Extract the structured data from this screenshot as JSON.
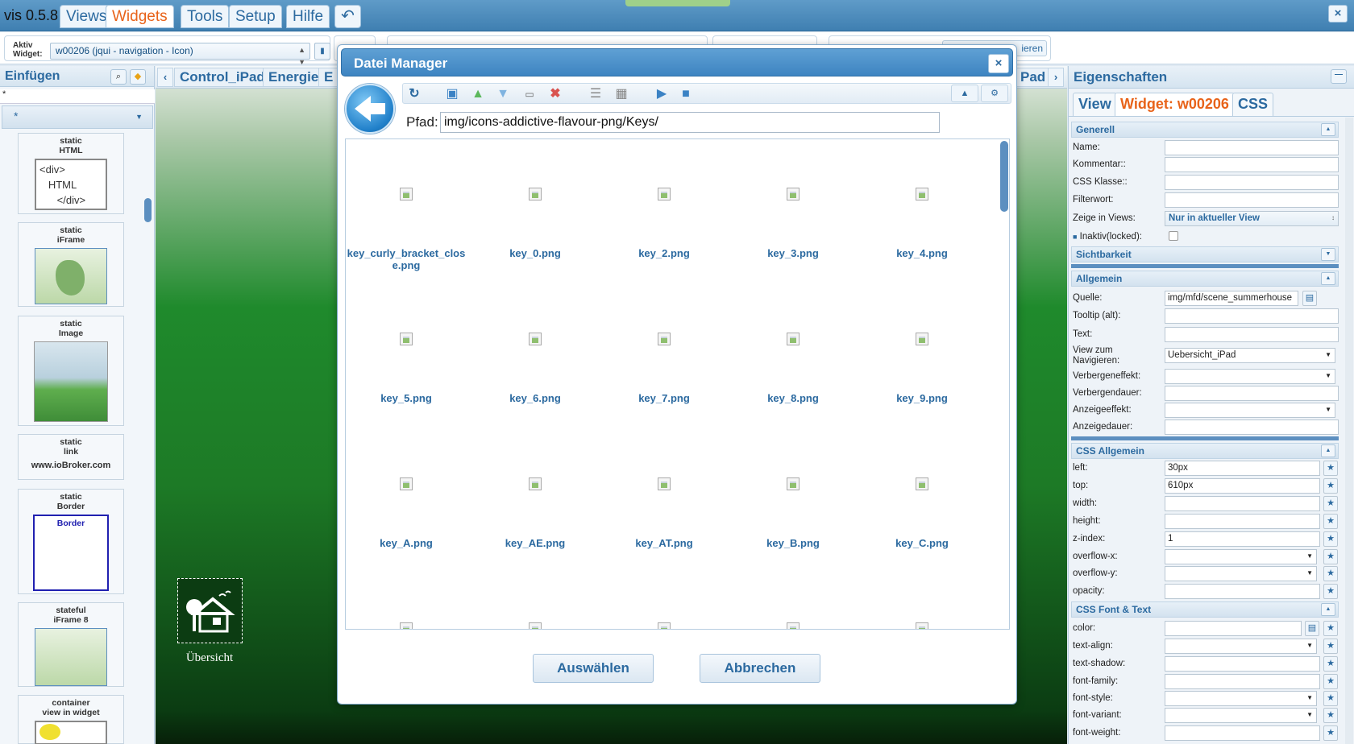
{
  "app": {
    "title": "vis 0.5.8",
    "menu": [
      "Views",
      "Widgets",
      "Tools",
      "Setup",
      "Hilfe"
    ],
    "active_menu": "Widgets",
    "undo_icon": "undo-arrow-icon",
    "close_icon": "close-icon"
  },
  "toolbar": {
    "aktiv_label_1": "Aktiv",
    "aktiv_label_2": "Widget:",
    "widget_select": "w00206 (jqui - navigation - Icon)",
    "partial_button": "ieren"
  },
  "left_panel": {
    "title": "Einfügen",
    "filter_value": "*",
    "filter_select": "*",
    "widgets": [
      {
        "set": "static",
        "name": "HTML",
        "preview": "<div>\n   HTML\n      </div>"
      },
      {
        "set": "static",
        "name": "iFrame",
        "preview": ""
      },
      {
        "set": "static",
        "name": "Image",
        "preview": ""
      },
      {
        "set": "static",
        "name": "link",
        "preview": "www.ioBroker.com"
      },
      {
        "set": "static",
        "name": "Border",
        "preview": "Border"
      },
      {
        "set": "stateful",
        "name": "iFrame 8",
        "preview": ""
      },
      {
        "set": "container",
        "name": "view in widget",
        "preview": ""
      }
    ]
  },
  "stage": {
    "tabs": [
      "Control_iPad",
      "Energie",
      "E",
      "Pad"
    ],
    "icon_label": "Übersicht"
  },
  "right_panel": {
    "title": "Eigenschaften",
    "tabs": [
      "View",
      "Widget: w00206",
      "CSS"
    ],
    "active_tab": "Widget: w00206",
    "sections": {
      "generell": "Generell",
      "sichtbarkeit": "Sichtbarkeit",
      "allgemein": "Allgemein",
      "css_allgemein": "CSS Allgemein",
      "css_font": "CSS Font & Text"
    },
    "generell": {
      "name_label": "Name:",
      "kommentar_label": "Kommentar::",
      "css_klasse_label": "CSS Klasse::",
      "filterwort_label": "Filterwort:",
      "zeige_label": "Zeige in Views:",
      "zeige_value": "Nur in aktueller View",
      "inaktiv_label": "Inaktiv(locked):"
    },
    "allgemein": {
      "quelle_label": "Quelle:",
      "quelle_value": "img/mfd/scene_summerhouse",
      "tooltip_label": "Tooltip (alt):",
      "text_label": "Text:",
      "view_nav_label_1": "View zum",
      "view_nav_label_2": "Navigieren:",
      "view_nav_value": "Uebersicht_iPad",
      "verbergeneffekt_label": "Verbergeneffekt:",
      "verbergendauer_label": "Verbergendauer:",
      "anzeigeeffekt_label": "Anzeigeeffekt:",
      "anzeigedauer_label": "Anzeigedauer:"
    },
    "css_allgemein": {
      "left_label": "left:",
      "left_value": "30px",
      "top_label": "top:",
      "top_value": "610px",
      "width_label": "width:",
      "height_label": "height:",
      "zindex_label": "z-index:",
      "zindex_value": "1",
      "overflowx_label": "overflow-x:",
      "overflowy_label": "overflow-y:",
      "opacity_label": "opacity:"
    },
    "css_font": {
      "color_label": "color:",
      "textalign_label": "text-align:",
      "textshadow_label": "text-shadow:",
      "fontfamily_label": "font-family:",
      "fontstyle_label": "font-style:",
      "fontvariant_label": "font-variant:",
      "fontweight_label": "font-weight:"
    }
  },
  "dialog": {
    "title": "Datei Manager",
    "pfad_label": "Pfad:",
    "pfad_value": "img/icons-addictive-flavour-png/Keys/",
    "files": [
      "key_curly_bracket_close.png",
      "key_0.png",
      "key_2.png",
      "key_3.png",
      "key_4.png",
      "key_5.png",
      "key_6.png",
      "key_7.png",
      "key_8.png",
      "key_9.png",
      "key_A.png",
      "key_AE.png",
      "key_AT.png",
      "key_B.png",
      "key_C.png",
      "",
      "",
      "",
      "",
      ""
    ],
    "ok_button": "Auswählen",
    "cancel_button": "Abbrechen",
    "toolbar_icons": [
      "refresh-icon",
      "new-folder-icon",
      "upload-icon",
      "download-icon",
      "rename-icon",
      "delete-icon",
      "list-view-icon",
      "table-view-icon",
      "play-icon",
      "stop-icon",
      "warning-icon",
      "settings-icon"
    ]
  }
}
